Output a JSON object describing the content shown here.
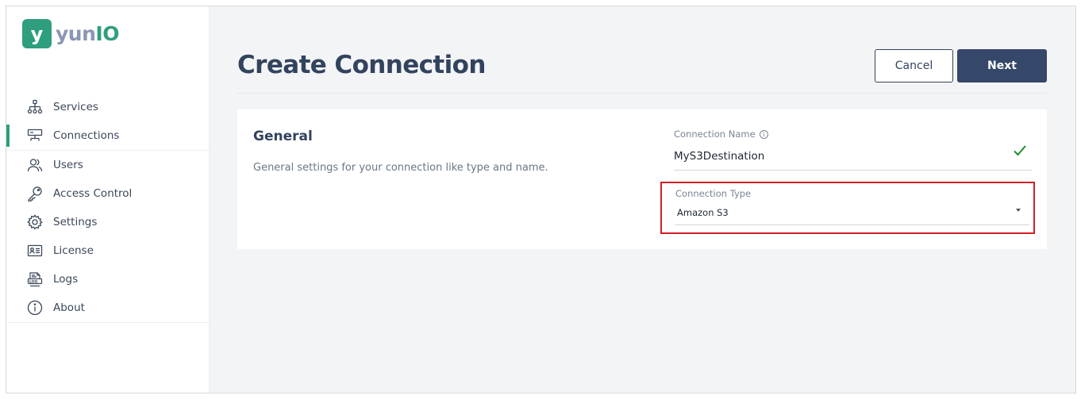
{
  "app": {
    "logo_mark": "y",
    "logo_text_a": "yun",
    "logo_text_b": "IO"
  },
  "colors": {
    "brand_green": "#2f9e7f",
    "primary": "#35486a",
    "highlight_red": "#d21f24"
  },
  "sidebar": {
    "items": [
      {
        "label": "Services",
        "icon": "sitemap-icon"
      },
      {
        "label": "Connections",
        "icon": "connection-icon",
        "active": true
      },
      {
        "label": "Users",
        "icon": "users-icon"
      },
      {
        "label": "Access Control",
        "icon": "key-icon"
      },
      {
        "label": "Settings",
        "icon": "gear-icon"
      },
      {
        "label": "License",
        "icon": "id-card-icon"
      },
      {
        "label": "Logs",
        "icon": "logs-icon"
      },
      {
        "label": "About",
        "icon": "info-icon"
      }
    ]
  },
  "page": {
    "title": "Create Connection",
    "cancel_label": "Cancel",
    "next_label": "Next"
  },
  "general": {
    "title": "General",
    "description": "General settings for your connection like type and name.",
    "name_label": "Connection Name",
    "name_value": "MyS3Destination",
    "type_label": "Connection Type",
    "type_value": "Amazon S3"
  }
}
